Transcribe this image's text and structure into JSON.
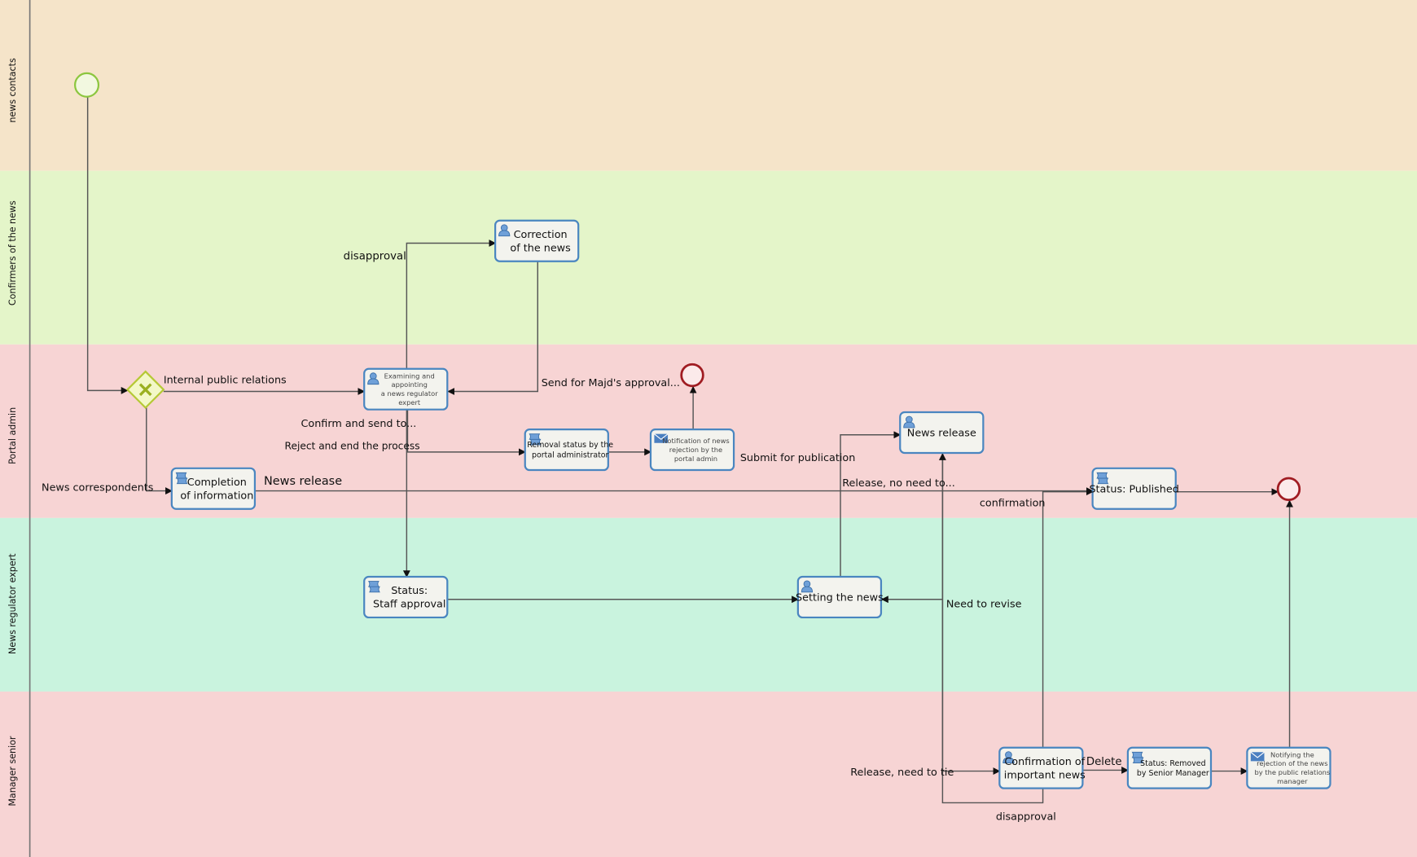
{
  "lanes": [
    {
      "label": "news contacts",
      "color": "#f5e4c9"
    },
    {
      "label": "Confirmers of the news",
      "color": "#e4f5c9"
    },
    {
      "label": "Portal admin",
      "color": "#f7d4d4"
    },
    {
      "label": "News regulator expert",
      "color": "#c9f3de"
    },
    {
      "label": "Manager senior",
      "color": "#f7d4d4"
    }
  ],
  "tasks": {
    "correction": {
      "icon": "user-icon",
      "lines": [
        "Correction",
        "of the news"
      ]
    },
    "examining": {
      "icon": "user-icon",
      "lines": [
        "Examining and",
        "appointing",
        "a news regulator",
        "expert"
      ]
    },
    "completion": {
      "icon": "script-icon",
      "lines": [
        "Completion",
        "of information"
      ]
    },
    "removal": {
      "icon": "script-icon",
      "lines": [
        "Removal status by the",
        "portal administrator"
      ]
    },
    "notification": {
      "icon": "envelope-icon",
      "lines": [
        "Notification of news",
        "rejection by the",
        "portal admin"
      ]
    },
    "news_release": {
      "icon": "user-icon",
      "lines": [
        "News release"
      ]
    },
    "published": {
      "icon": "script-icon",
      "lines": [
        "Status: Published"
      ]
    },
    "staff_approval": {
      "icon": "script-icon",
      "lines": [
        "Status:",
        "Staff approval"
      ]
    },
    "setting": {
      "icon": "user-icon",
      "lines": [
        "Setting the news"
      ]
    },
    "confirmation": {
      "icon": "user-icon",
      "lines": [
        "Confirmation of",
        "important news"
      ]
    },
    "removed": {
      "icon": "script-icon",
      "lines": [
        "Status: Removed",
        "by Senior Manager"
      ]
    },
    "notifying": {
      "icon": "envelope-icon",
      "lines": [
        "Notifying the",
        "rejection of the news",
        "by the public relations",
        "manager"
      ]
    }
  },
  "flow_labels": {
    "internal_pr": "Internal public relations",
    "news_correspondents": "News correspondents",
    "disapproval_top": "disapproval",
    "send_majd": "Send for Majd's approval...",
    "confirm_send": "Confirm and send to...",
    "reject_end": "Reject and end the process",
    "news_release_flow": "News release",
    "submit_publication": "Submit for publication",
    "release_no_need": "Release, no need to...",
    "confirmation": "confirmation",
    "need_revise": "Need to revise",
    "release_need_tie": "Release, need to tie",
    "delete": "Delete",
    "disapproval_bottom": "disapproval"
  },
  "colors": {
    "task_border": "#4a86c0",
    "start_event": "#8cc63f",
    "end_event": "#a01c22",
    "gateway": "#b5c935"
  }
}
